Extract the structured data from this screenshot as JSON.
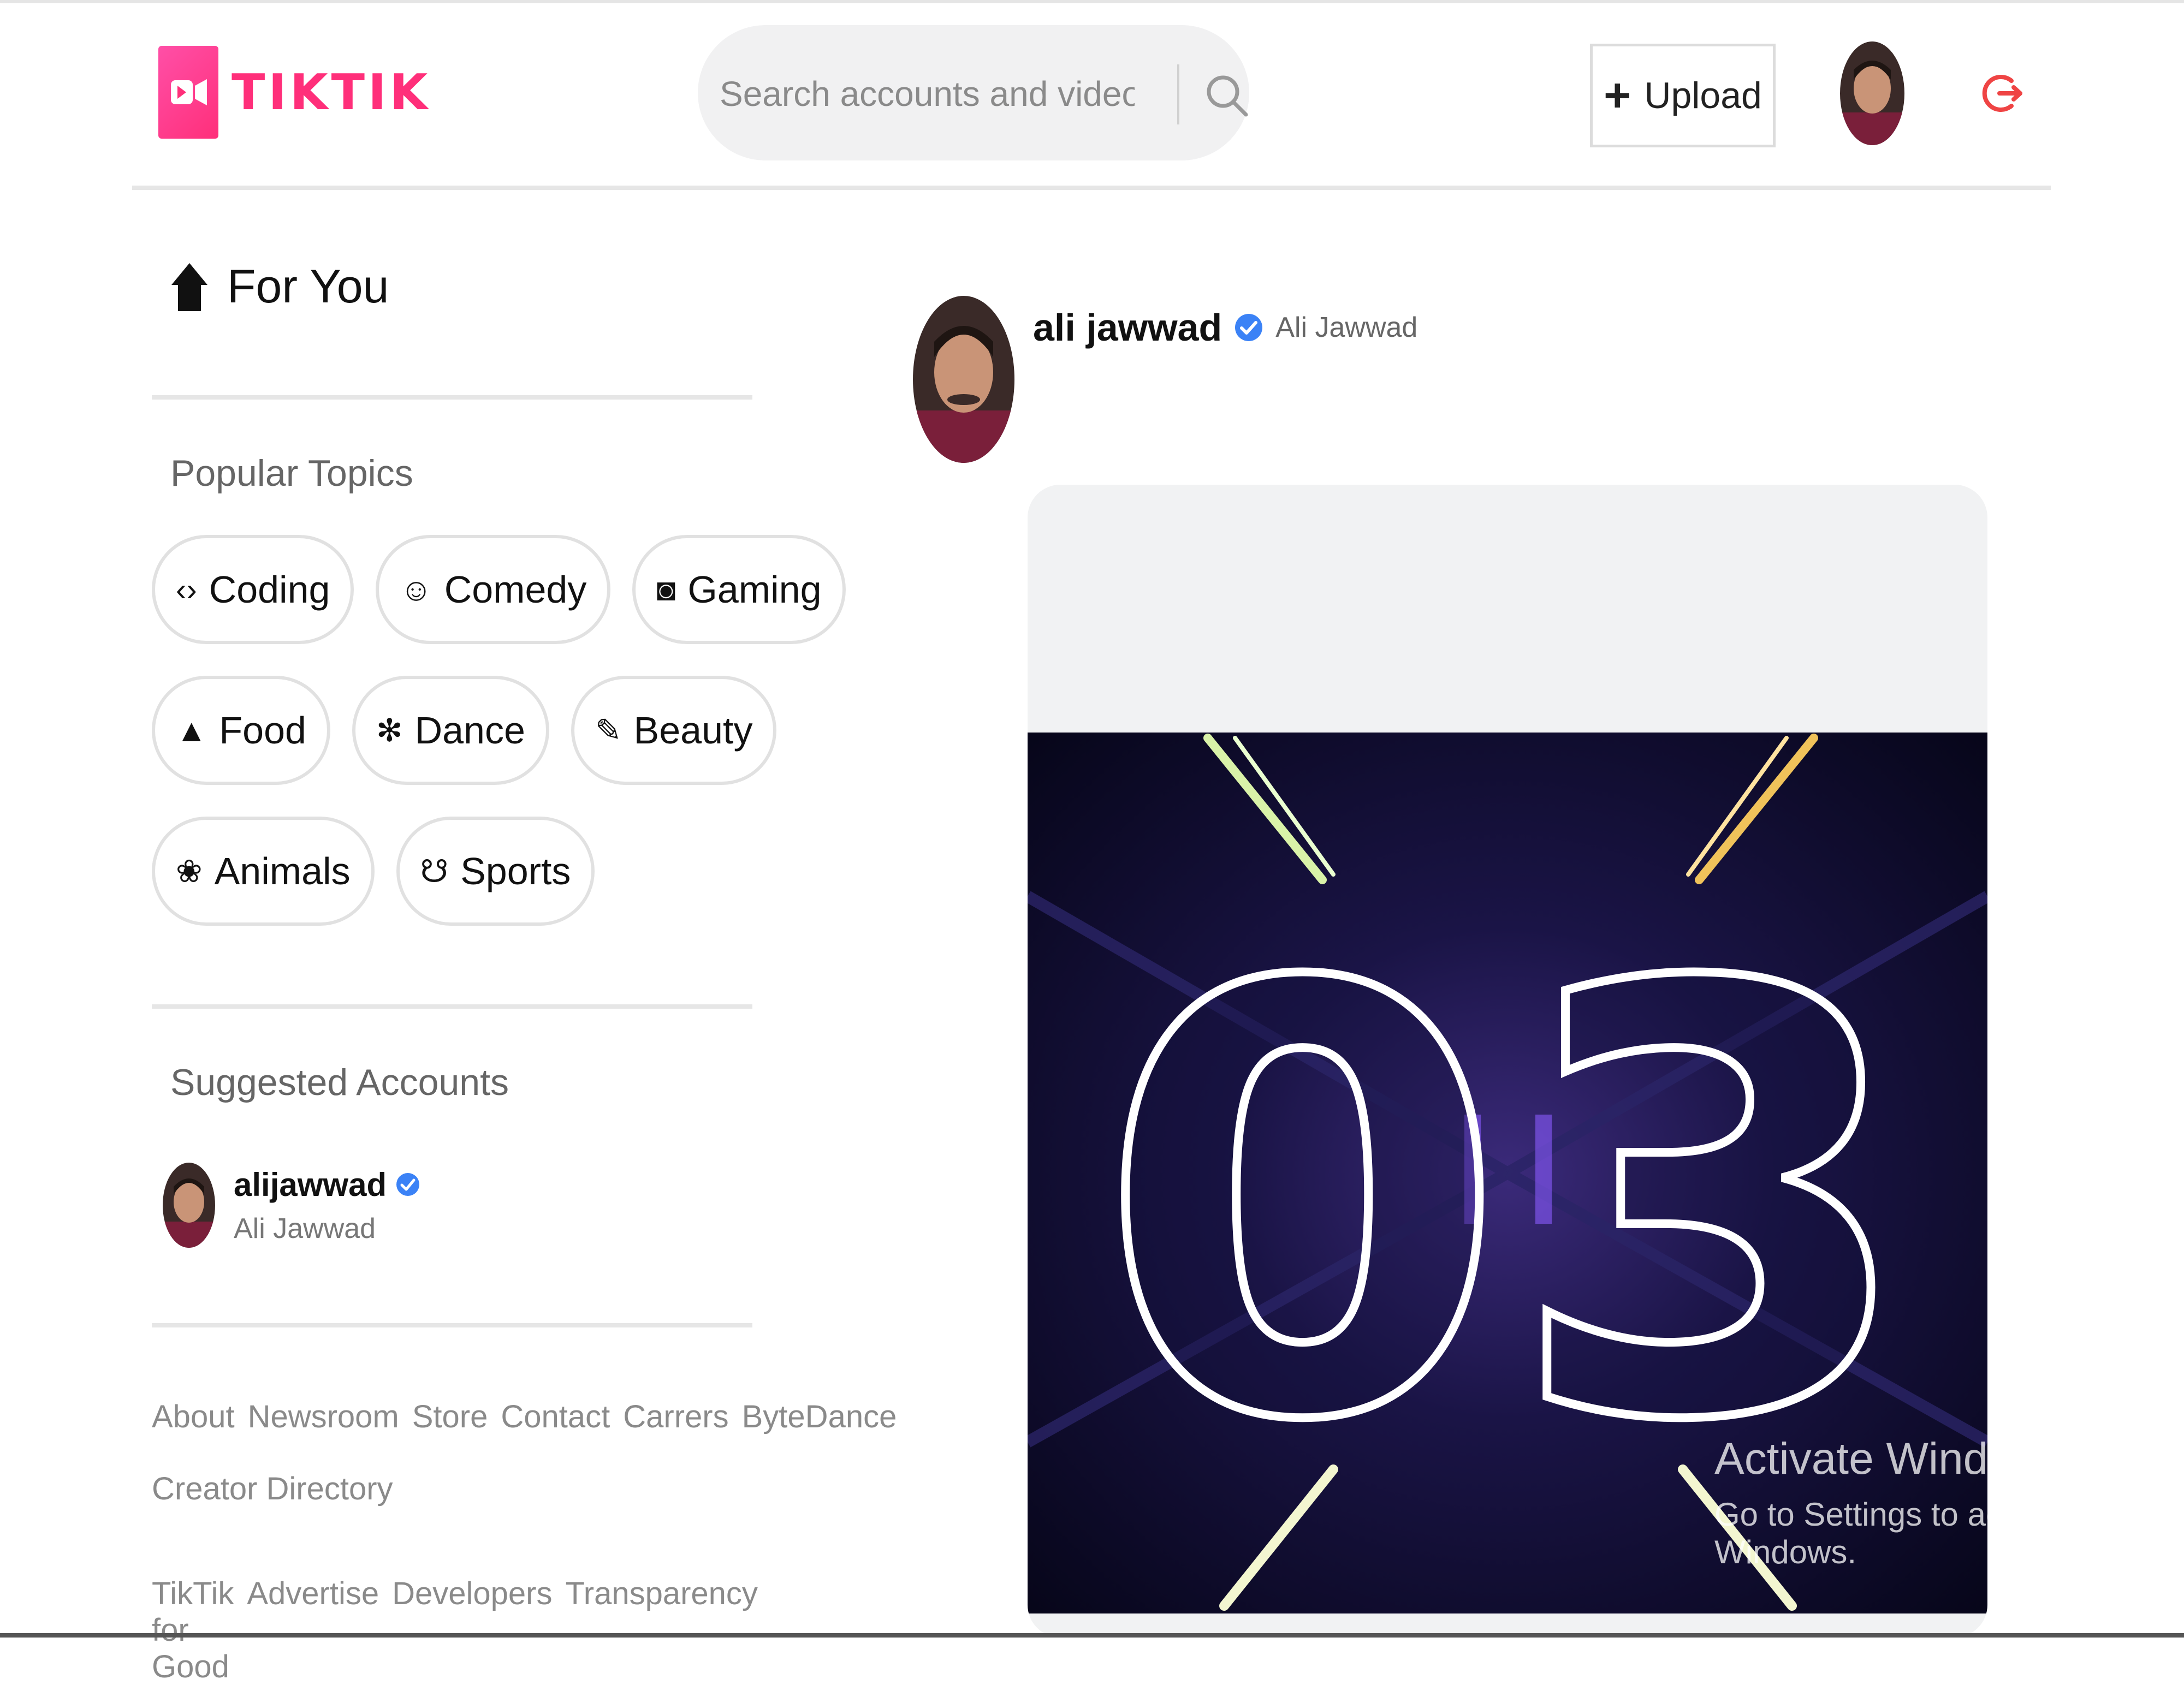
{
  "app": {
    "logo_text": "TIKTIK"
  },
  "search": {
    "placeholder": "Search accounts and videos"
  },
  "header": {
    "upload_label": "Upload"
  },
  "sidebar": {
    "for_you_label": "For You",
    "popular_topics_title": "Popular Topics",
    "topics": [
      {
        "label": "Coding",
        "icon": "code-icon"
      },
      {
        "label": "Comedy",
        "icon": "laugh-emoji-icon"
      },
      {
        "label": "Gaming",
        "icon": "gamepad-icon"
      },
      {
        "label": "Food",
        "icon": "cake-icon"
      },
      {
        "label": "Dance",
        "icon": "dance-icon"
      },
      {
        "label": "Beauty",
        "icon": "brush-icon"
      },
      {
        "label": "Animals",
        "icon": "paw-icon"
      },
      {
        "label": "Sports",
        "icon": "medal-icon"
      }
    ],
    "suggested_accounts_title": "Suggested Accounts",
    "suggested_accounts": [
      {
        "handle": "alijawwad",
        "name": "Ali Jawwad",
        "verified": true
      }
    ],
    "footer_row1": [
      "About",
      "Newsroom",
      "Store",
      "Contact",
      "Carrers",
      "ByteDance"
    ],
    "footer_row2": [
      "Creator Directory"
    ],
    "footer_row3": [
      "TikTik for Good",
      "Advertise",
      "Developers",
      "Transparency"
    ]
  },
  "feed": {
    "post": {
      "handle": "ali jawwad",
      "name": "Ali Jawwad",
      "verified": true,
      "video_overlay_text": "03"
    }
  },
  "os_watermark": {
    "line1": "Activate Windows",
    "line2": "Go to Settings to activate Windows."
  },
  "colors": {
    "brand": "#ff2f7a",
    "verified": "#3b82f6",
    "logout": "#ef4444"
  }
}
